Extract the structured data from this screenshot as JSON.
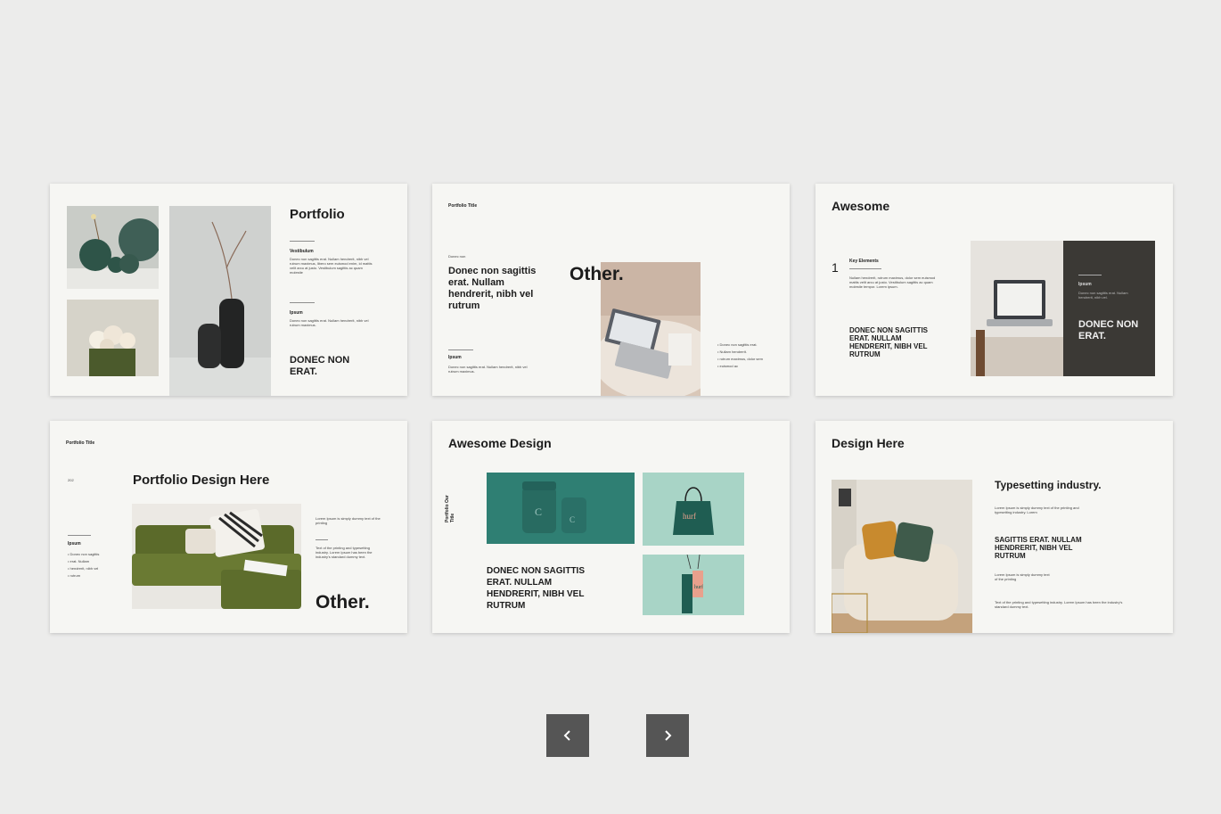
{
  "slides": [
    {
      "title": "Portfolio",
      "sec1_label": "Vestibulum",
      "sec1_body": "Donec non sagittis erat. Nullam hendrerit, nibh vel rutrum maximus, libero sem euismod enim, id mattis velit arcu at justo. Vestibulum sagittis ac quam molestie",
      "sec2_label": "Ipsum",
      "sec2_body": "Donec non sagittis erat. Nullam hendrerit, nibh vel rutrum maximus.",
      "headline": "DONEC NON ERAT."
    },
    {
      "small_title": "Portfolio Title",
      "kicker": "Donec non",
      "body_title": "Donec non sagittis erat. Nullam hendrerit, nibh vel rutrum",
      "big_word": "Other.",
      "label": "Ipsum",
      "label_body": "Donec non sagittis erat. Nullam hendrerit, nibh vel rutrum maximus.",
      "bullets": [
        "Donec non sagittis erat.",
        "Nullam hendrerit.",
        "rutrum maximus, dolor sem",
        "euismod ac"
      ]
    },
    {
      "title": "Awesome",
      "number": "1",
      "key_label": "Key Elements",
      "key_body": "Nullam hendrerit, rutrum maximus, dolor sem euismod mattis velit arcu at justo. Vestibulum sagittis ac quam molestie tempor. Lorem ipsum.",
      "headline": "DONEC NON SAGITTIS ERAT. NULLAM HENDRERIT, NIBH VEL RUTRUM",
      "panel_label": "Ipsum",
      "panel_body": "Donec non sagittis erat. Nullam hendrerit, nibh vel.",
      "panel_headline": "DONEC NON ERAT."
    },
    {
      "small_title": "Portfolio Title",
      "number": "202",
      "title": "Portfolio Design Here",
      "label": "Ipsum",
      "bullets": [
        "Donec non sagittis",
        "erat. Nullam",
        "hendrerit, nibh vel",
        "rutrum"
      ],
      "text1": "Lorem Ipsum is simply dummy text of the printing",
      "text2": "Text of the printing and typesetting industry. Lorem Ipsum has been the industry's standard dummy text.",
      "big_word": "Other."
    },
    {
      "title": "Awesome Design",
      "side_label": "Portfolio Our Title",
      "headline": "DONEC NON SAGITTIS ERAT. NULLAM HENDRERIT, NIBH VEL RUTRUM",
      "bag_brand": "hurf",
      "tag_brand": "hurf",
      "jar_letter": "C"
    },
    {
      "title": "Design Here",
      "subtitle": "Typesetting industry.",
      "body1": "Lorem Ipsum is simply dummy text of the printing and typesetting industry. Lorem",
      "headline": "SAGITTIS ERAT. NULLAM HENDRERIT, NIBH VEL RUTRUM",
      "body2": "Lorem Ipsum is simply dummy text of the printing",
      "body3": "Text of the printing and typesetting industry. Lorem Ipsum has been the industry's standard dummy text."
    }
  ],
  "nav": {
    "prev_icon": "chevron-left-icon",
    "next_icon": "chevron-right-icon"
  },
  "colors": {
    "background": "#ececeb",
    "slide": "#f6f6f3",
    "nav_button": "#555555",
    "dark_panel": "#3b3935",
    "teal": "#2f7f73"
  }
}
